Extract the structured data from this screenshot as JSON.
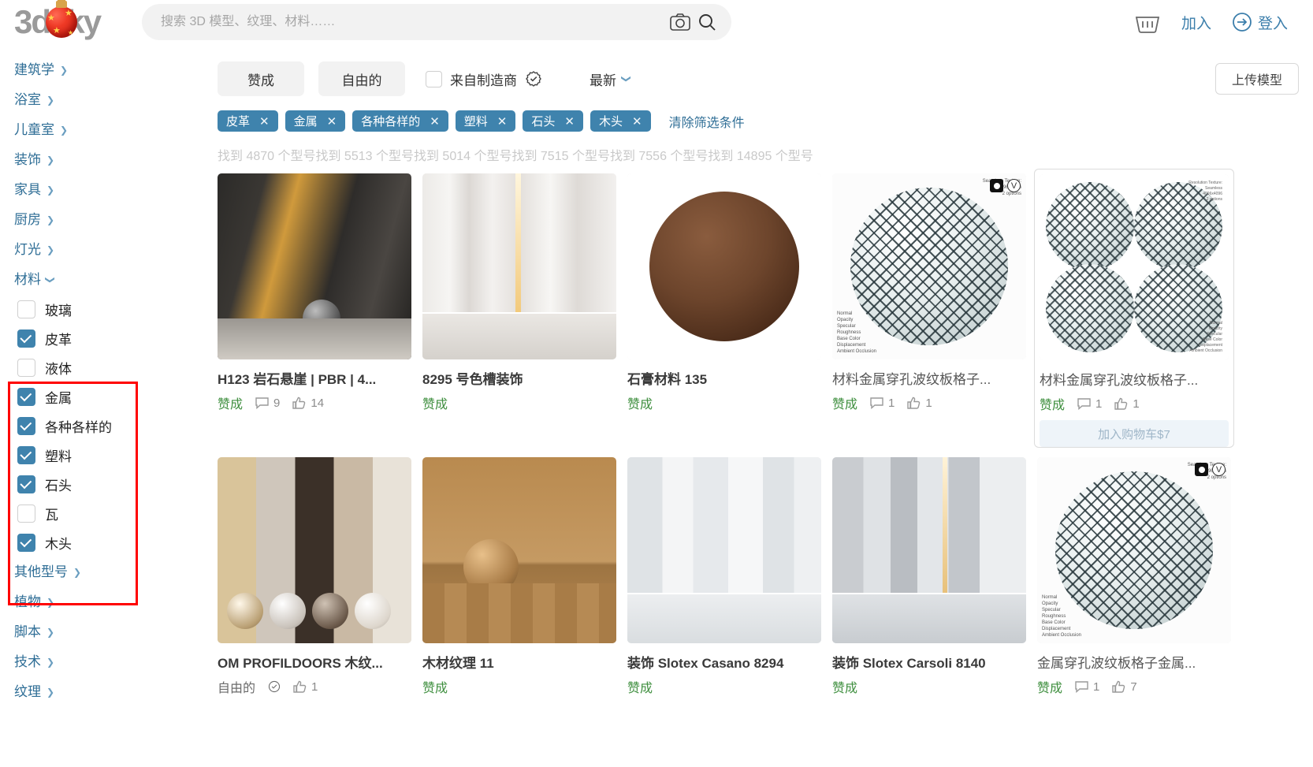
{
  "header": {
    "logo_text": "3dsky",
    "search_placeholder": "搜索 3D 模型、纹理、材料……",
    "search_value": "",
    "camera_icon": "camera-icon",
    "search_icon": "search-icon",
    "basket_icon": "basket-icon",
    "join_label": "加入",
    "login_label": "登入"
  },
  "sidebar": {
    "nav_top": [
      {
        "label": "建筑学"
      },
      {
        "label": "浴室"
      },
      {
        "label": "儿童室"
      },
      {
        "label": "装饰"
      },
      {
        "label": "家具"
      },
      {
        "label": "厨房"
      },
      {
        "label": "灯光"
      }
    ],
    "expanded": {
      "label": "材料"
    },
    "materials": [
      {
        "label": "玻璃",
        "checked": false
      },
      {
        "label": "皮革",
        "checked": true
      },
      {
        "label": "液体",
        "checked": false
      },
      {
        "label": "金属",
        "checked": true
      },
      {
        "label": "各种各样的",
        "checked": true
      },
      {
        "label": "塑料",
        "checked": true
      },
      {
        "label": "石头",
        "checked": true
      },
      {
        "label": "瓦",
        "checked": false
      },
      {
        "label": "木头",
        "checked": true
      }
    ],
    "nav_bottom": [
      {
        "label": "其他型号"
      },
      {
        "label": "植物"
      },
      {
        "label": "脚本"
      },
      {
        "label": "技术"
      },
      {
        "label": "纹理"
      }
    ],
    "highlight_color": "#ff0000"
  },
  "toolbar": {
    "pill_pro": "赞成",
    "pill_free": "自由的",
    "manufacturer_label": "来自制造商",
    "manufacturer_checked": false,
    "sort_label": "最新",
    "upload_label": "上传模型"
  },
  "filters": {
    "chips": [
      "皮革",
      "金属",
      "各种各样的",
      "塑料",
      "石头",
      "木头"
    ],
    "chip_remove": "✕",
    "clear_label": "清除筛选条件",
    "chip_color": "#3f83ad"
  },
  "results": {
    "counts_text": "找到 4870 个型号找到 5513 个型号找到 5014 个型号找到 7515 个型号找到 7556 个型号找到 14895 个型号"
  },
  "cards": [
    {
      "title": "H123 岩石悬崖 | PBR | 4...",
      "status": "赞成",
      "status_color": "green",
      "comments": "9",
      "likes": "14",
      "art": "rock",
      "badges": false,
      "hovered": false
    },
    {
      "title": "8295 号色槽装饰",
      "status": "赞成",
      "status_color": "green",
      "comments": "",
      "likes": "",
      "art": "marble",
      "badges": false,
      "hovered": false
    },
    {
      "title": "石膏材料 135",
      "status": "赞成",
      "status_color": "green",
      "comments": "",
      "likes": "",
      "art": "brownsphere",
      "badges": false,
      "hovered": false
    },
    {
      "title": "材料金属穿孔波纹板格子...",
      "status": "赞成",
      "status_color": "green",
      "comments": "1",
      "likes": "1",
      "art": "mesh",
      "badges": true,
      "hovered": false
    },
    {
      "title": "材料金属穿孔波纹板格子...",
      "status": "赞成",
      "status_color": "green",
      "comments": "1",
      "likes": "1",
      "art": "quad",
      "badges": false,
      "hovered": true,
      "cart_label": "加入购物车$7"
    },
    {
      "title": "OM PROFILDOORS 木纹...",
      "status": "自由的",
      "status_color": "grey",
      "comments": "",
      "likes": "1",
      "art": "woodstrips",
      "badges": false,
      "hovered": false,
      "verified": true
    },
    {
      "title": "木材纹理 11",
      "status": "赞成",
      "status_color": "green",
      "comments": "",
      "likes": "",
      "art": "woodwall",
      "badges": false,
      "hovered": false
    },
    {
      "title": "装饰 Slotex Casano 8294",
      "status": "赞成",
      "status_color": "green",
      "comments": "",
      "likes": "",
      "art": "marble2",
      "badges": false,
      "hovered": false
    },
    {
      "title": "装饰 Slotex Carsoli 8140",
      "status": "赞成",
      "status_color": "green",
      "comments": "",
      "likes": "",
      "art": "marble3",
      "badges": false,
      "hovered": false
    },
    {
      "title": "金属穿孔波纹板格子金属...",
      "status": "赞成",
      "status_color": "green",
      "comments": "1",
      "likes": "7",
      "art": "mesh",
      "badges": true,
      "hovered": false
    }
  ],
  "thumb_text": {
    "mesh_top": "Seamless Texture:\n4096x4096\n2 options",
    "mesh_bottom": "Normal\nOpacity\nSpecular\nRoughness\nBase Color\nDisplacement\nAmbient Occlusion",
    "quad_top": "Resolution Texture:\nSeamless\n4096x4096\n2 options",
    "quad_bottom": "Normal\nOpacity\nSpecular\nBase Color\nDisplacement\nAmbient Occlusion"
  }
}
